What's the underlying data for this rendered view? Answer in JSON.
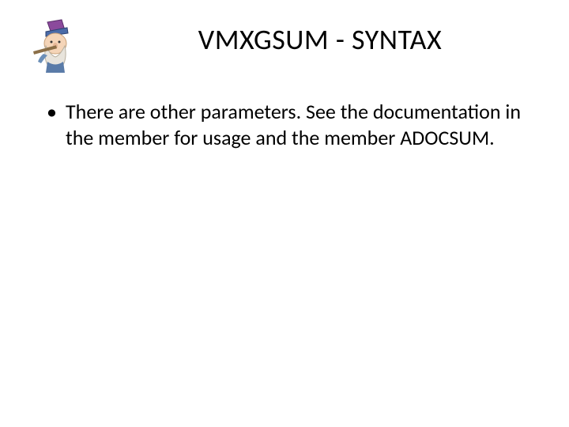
{
  "slide": {
    "title": "VMXGSUM - SYNTAX",
    "logo_alt": "wizard-character-illustration",
    "bullets": [
      "There are other parameters. See the documentation in the member for usage and the member ADOCSUM."
    ]
  }
}
